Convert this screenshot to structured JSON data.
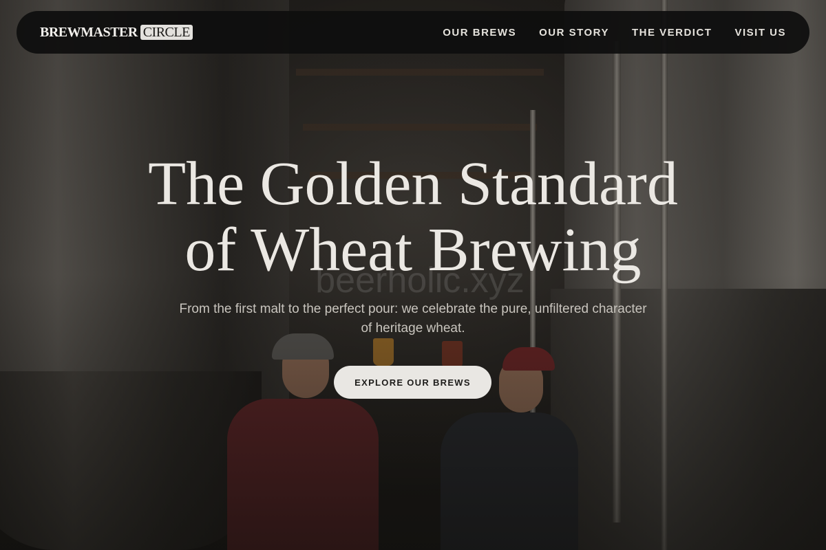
{
  "brand": {
    "name_main": "BREWMASTER",
    "name_badge": "CIRCLE"
  },
  "nav": {
    "links": [
      {
        "label": "OUR BREWS"
      },
      {
        "label": "OUR STORY"
      },
      {
        "label": "THE VERDICT"
      },
      {
        "label": "VISIT US"
      }
    ]
  },
  "hero": {
    "headline_line1": "The Golden Standard",
    "headline_line2": "of Wheat Brewing",
    "watermark": "beerholic.xyz",
    "subtitle": "From the first malt to the perfect pour: we celebrate the pure, unfiltered character of heritage wheat.",
    "cta_label": "EXPLORE OUR BREWS"
  },
  "colors": {
    "nav_background": "#0e0e0e",
    "cta_background": "#e9e7e3",
    "headline_text": "#ebe8e3"
  }
}
